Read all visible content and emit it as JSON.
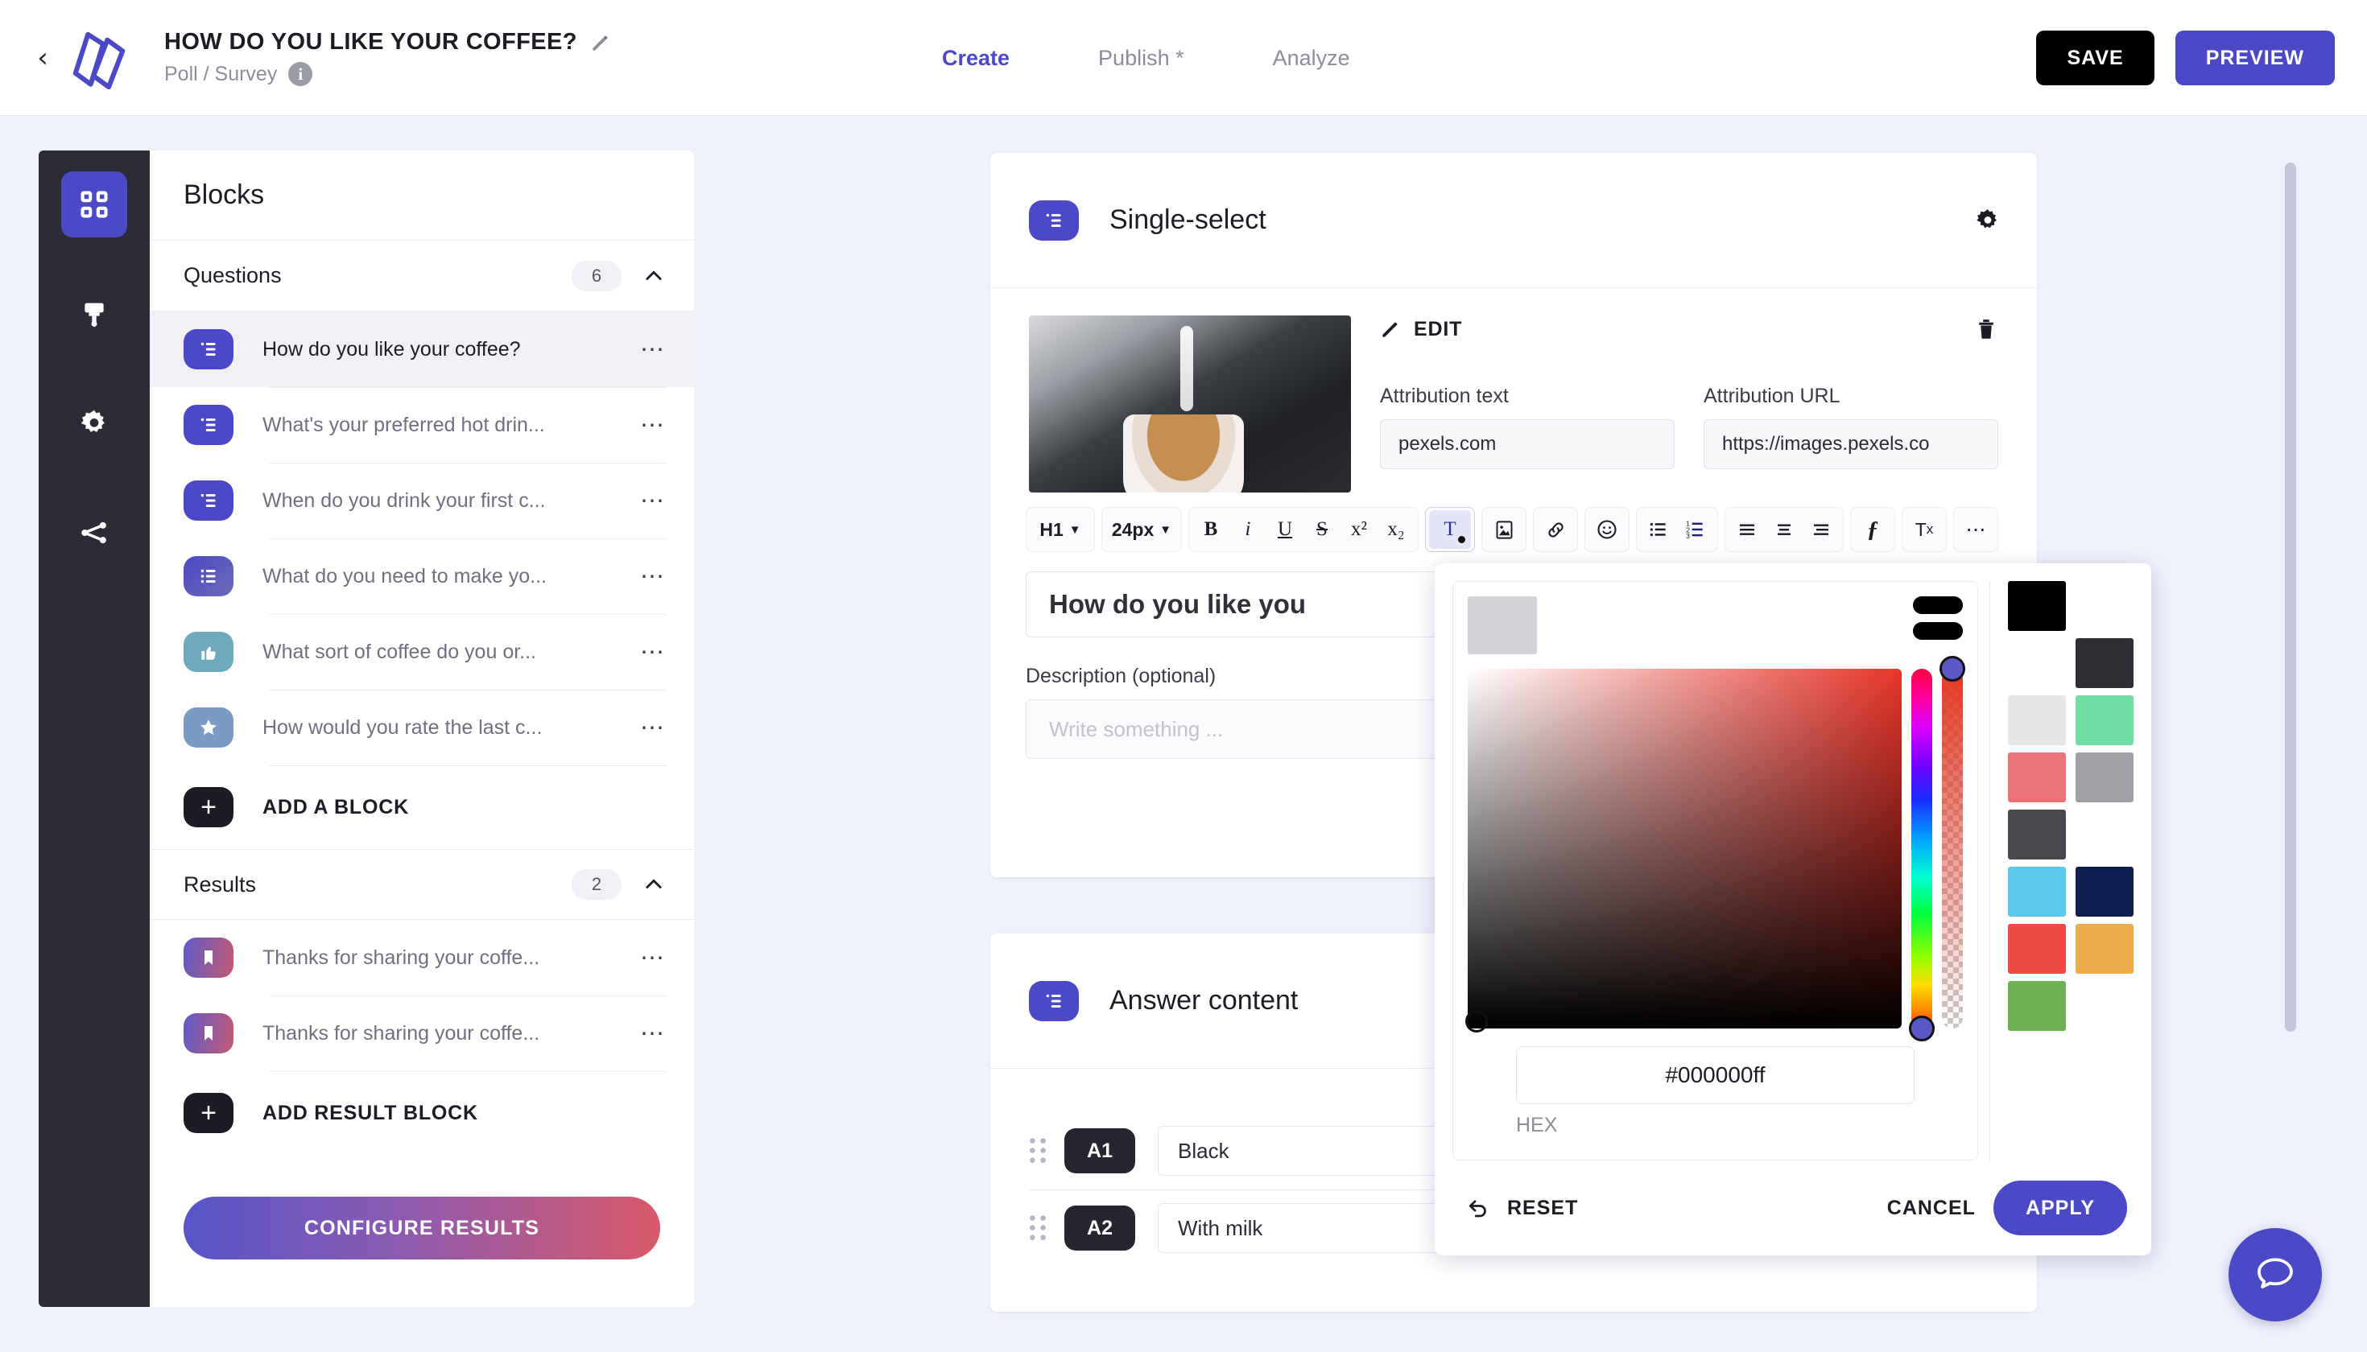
{
  "header": {
    "back_icon": "chevron-left-icon",
    "logo_icon": "app-logo-icon",
    "project_title": "HOW DO YOU LIKE YOUR COFFEE?",
    "edit_title_icon": "pencil-icon",
    "project_subtitle": "Poll / Survey",
    "info_icon_label": "i",
    "nav": [
      {
        "label": "Create",
        "active": true
      },
      {
        "label": "Publish *",
        "active": false
      },
      {
        "label": "Analyze",
        "active": false
      }
    ],
    "save_label": "SAVE",
    "preview_label": "PREVIEW"
  },
  "rail": {
    "items": [
      {
        "icon": "grid-blocks-icon",
        "active": true
      },
      {
        "icon": "paint-brush-icon",
        "active": false
      },
      {
        "icon": "gear-icon",
        "active": false
      },
      {
        "icon": "share-branch-icon",
        "active": false
      }
    ]
  },
  "blocks_panel": {
    "title": "Blocks",
    "questions_section": {
      "label": "Questions",
      "count": "6",
      "collapse_icon": "chevron-up-icon",
      "items": [
        {
          "label": "How do you like your coffee?",
          "icon": "single-select-icon",
          "selected": true
        },
        {
          "label": "What's your preferred hot drin...",
          "icon": "single-select-icon",
          "selected": false
        },
        {
          "label": "When do you drink your first c...",
          "icon": "single-select-icon",
          "selected": false
        },
        {
          "label": "What do you need to make yo...",
          "icon": "multi-select-icon",
          "selected": false
        },
        {
          "label": "What sort of coffee do you or...",
          "icon": "thumbs-up-icon",
          "selected": false
        },
        {
          "label": "How would you rate the last c...",
          "icon": "star-icon",
          "selected": false
        }
      ],
      "add_label": "ADD A BLOCK"
    },
    "results_section": {
      "label": "Results",
      "count": "2",
      "collapse_icon": "chevron-up-icon",
      "items": [
        {
          "label": "Thanks for sharing your coffe...",
          "icon": "bookmark-icon"
        },
        {
          "label": "Thanks for sharing your coffe...",
          "icon": "bookmark-icon"
        }
      ],
      "add_label": "ADD RESULT BLOCK"
    },
    "configure_results_label": "CONFIGURE RESULTS"
  },
  "single_select_card": {
    "title": "Single-select",
    "type_icon": "single-select-icon",
    "settings_icon": "gear-icon",
    "media": {
      "edit_label": "EDIT",
      "edit_icon": "pencil-icon",
      "delete_icon": "trash-icon",
      "attribution_text_label": "Attribution text",
      "attribution_text_value": "pexels.com",
      "attribution_url_label": "Attribution URL",
      "attribution_url_value": "https://images.pexels.co"
    },
    "toolbar": {
      "heading_select": "H1",
      "size_select": "24px",
      "bold": "B",
      "italic": "i",
      "underline": "U",
      "strike": "S",
      "superscript": "x²",
      "subscript": "x₂",
      "text_color": "T",
      "image": "image-icon",
      "link": "link-icon",
      "emoji": "emoji-icon",
      "bullet_list": "bullet-list-icon",
      "numbered_list": "numbered-list-icon",
      "align_left": "align-left-icon",
      "align_center": "align-center-icon",
      "align_right": "align-right-icon",
      "formula": "formula-icon",
      "clear_format": "clear-format-icon",
      "more": "more-icon"
    },
    "heading_value": "How do you like you",
    "description_label": "Description (optional)",
    "description_placeholder": "Write something ..."
  },
  "answer_card": {
    "title": "Answer content",
    "type_icon": "single-select-icon",
    "rows": [
      {
        "tag": "A1",
        "value": "Black"
      },
      {
        "tag": "A2",
        "value": "With milk"
      }
    ]
  },
  "color_picker": {
    "hex_value": "#000000ff",
    "hex_label": "HEX",
    "reset_label": "RESET",
    "reset_icon": "undo-icon",
    "cancel_label": "CANCEL",
    "apply_label": "APPLY",
    "preview_color": "#d4d4d8",
    "swatches": [
      [
        "#000000",
        null
      ],
      [
        null,
        "#2f2f33"
      ],
      [
        "#e7e7e9",
        "#72dda5"
      ],
      [
        "#ed7379",
        "#a0a0a4"
      ],
      [
        "#4a4a4e",
        null
      ],
      [
        "#5cc9ea",
        "#0c1f4f"
      ],
      [
        "#e84c43",
        "#eead4c"
      ],
      [
        "#6db054",
        null
      ]
    ]
  },
  "chat_fab": {
    "icon": "chat-bubble-icon"
  },
  "scrollbar": {
    "name": "vertical-scrollbar"
  }
}
